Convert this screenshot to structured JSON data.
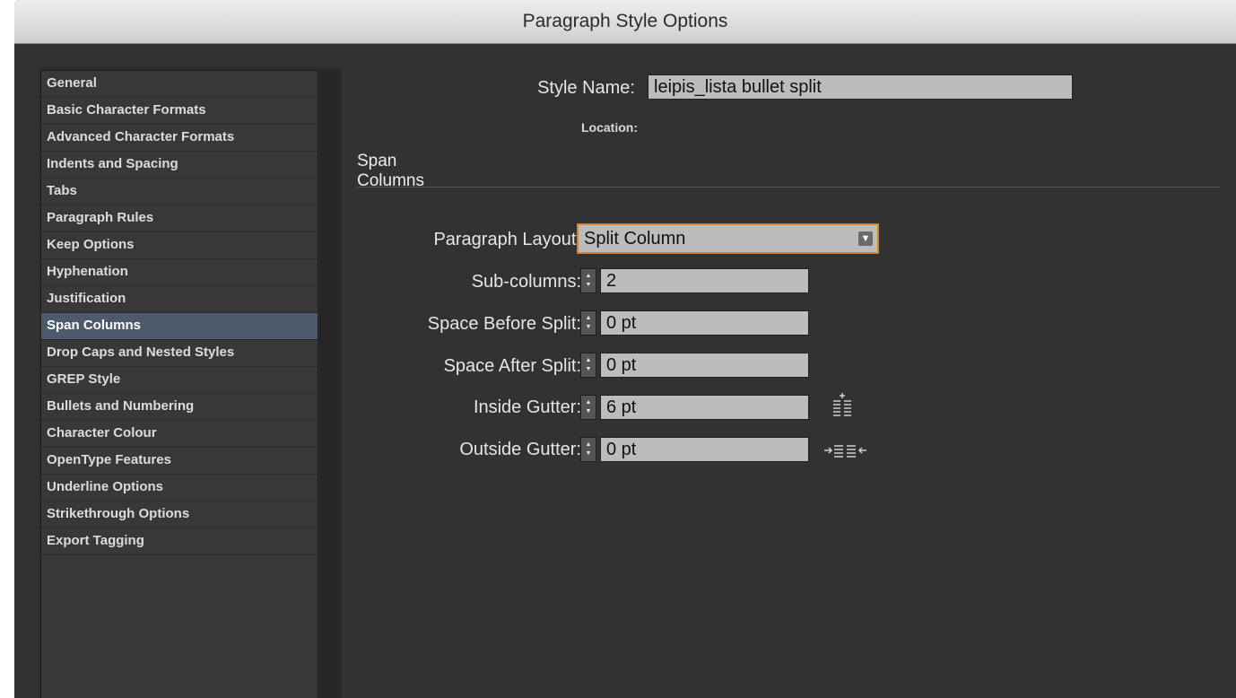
{
  "window": {
    "title": "Paragraph Style Options"
  },
  "sidebar": {
    "items": [
      {
        "label": "General",
        "selected": false
      },
      {
        "label": "Basic Character Formats",
        "selected": false
      },
      {
        "label": "Advanced Character Formats",
        "selected": false
      },
      {
        "label": "Indents and Spacing",
        "selected": false
      },
      {
        "label": "Tabs",
        "selected": false
      },
      {
        "label": "Paragraph Rules",
        "selected": false
      },
      {
        "label": "Keep Options",
        "selected": false
      },
      {
        "label": "Hyphenation",
        "selected": false
      },
      {
        "label": "Justification",
        "selected": false
      },
      {
        "label": "Span Columns",
        "selected": true
      },
      {
        "label": "Drop Caps and Nested Styles",
        "selected": false
      },
      {
        "label": "GREP Style",
        "selected": false
      },
      {
        "label": "Bullets and Numbering",
        "selected": false
      },
      {
        "label": "Character Colour",
        "selected": false
      },
      {
        "label": "OpenType Features",
        "selected": false
      },
      {
        "label": "Underline Options",
        "selected": false
      },
      {
        "label": "Strikethrough Options",
        "selected": false
      },
      {
        "label": "Export Tagging",
        "selected": false
      }
    ]
  },
  "main": {
    "style_name_label": "Style Name:",
    "style_name_value": "leipis_lista bullet split",
    "location_label": "Location:",
    "section_title": "Span Columns",
    "paragraph_layout_label": "Paragraph Layout:",
    "paragraph_layout_value": "Split Column",
    "sub_columns_label": "Sub-columns:",
    "sub_columns_value": "2",
    "space_before_label": "Space Before Split:",
    "space_before_value": "0 pt",
    "space_after_label": "Space After Split:",
    "space_after_value": "0 pt",
    "inside_gutter_label": "Inside Gutter:",
    "inside_gutter_value": "6 pt",
    "outside_gutter_label": "Outside Gutter:",
    "outside_gutter_value": "0 pt"
  },
  "icons": {
    "stepper": "stepper-arrows-icon",
    "dropdown": "chevron-down-icon",
    "inside_gutter": "inside-gutter-icon",
    "outside_gutter": "outside-gutter-icon"
  },
  "colors": {
    "dialog_bg": "#323232",
    "selected_item": "#4d5a6b",
    "focus_ring": "#d8822a"
  }
}
